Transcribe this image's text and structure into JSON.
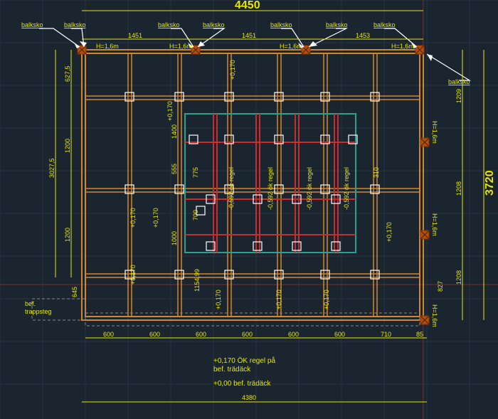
{
  "top_dim_main": "4450",
  "right_dim_main": "3720",
  "bottom_dim_main": "4380",
  "labels": {
    "balksko": "balksko",
    "h16": "H=1,6m",
    "bef_trappsteg": "bef.\ntrappsteg",
    "note1": "+0,170 ÖK regel på",
    "note2": "bef. trädäck",
    "note3": "+0,00 bef. trädäck"
  },
  "top_spans": [
    "1451",
    "1451",
    "1453"
  ],
  "left_spans": [
    "627,5",
    "1200",
    "1200"
  ],
  "left_total": "3027,5",
  "right_spans": [
    "1209",
    "1208",
    "1208"
  ],
  "inner_left": [
    "1400",
    "555",
    "775",
    "700",
    "1000"
  ],
  "inner_h": [
    "+0,170",
    "+0,170",
    "+0,170",
    "+0,170",
    "+0,170",
    "+0,170",
    "+0,170",
    "+0,170"
  ],
  "inner_reg": [
    "-0,592 ök regel",
    "-0,592 ök regel",
    "-0,592 ök regel",
    "-0,592 ök regel"
  ],
  "inner_l2": "1154,99",
  "right_small": "310",
  "bottom_spans": [
    "600",
    "600",
    "600",
    "600",
    "600",
    "600",
    "710",
    "85"
  ],
  "left_small": "645",
  "right_h16": [
    "H=1,6m",
    "H=1,6m",
    "H=1,6m"
  ],
  "right_small2": "827"
}
